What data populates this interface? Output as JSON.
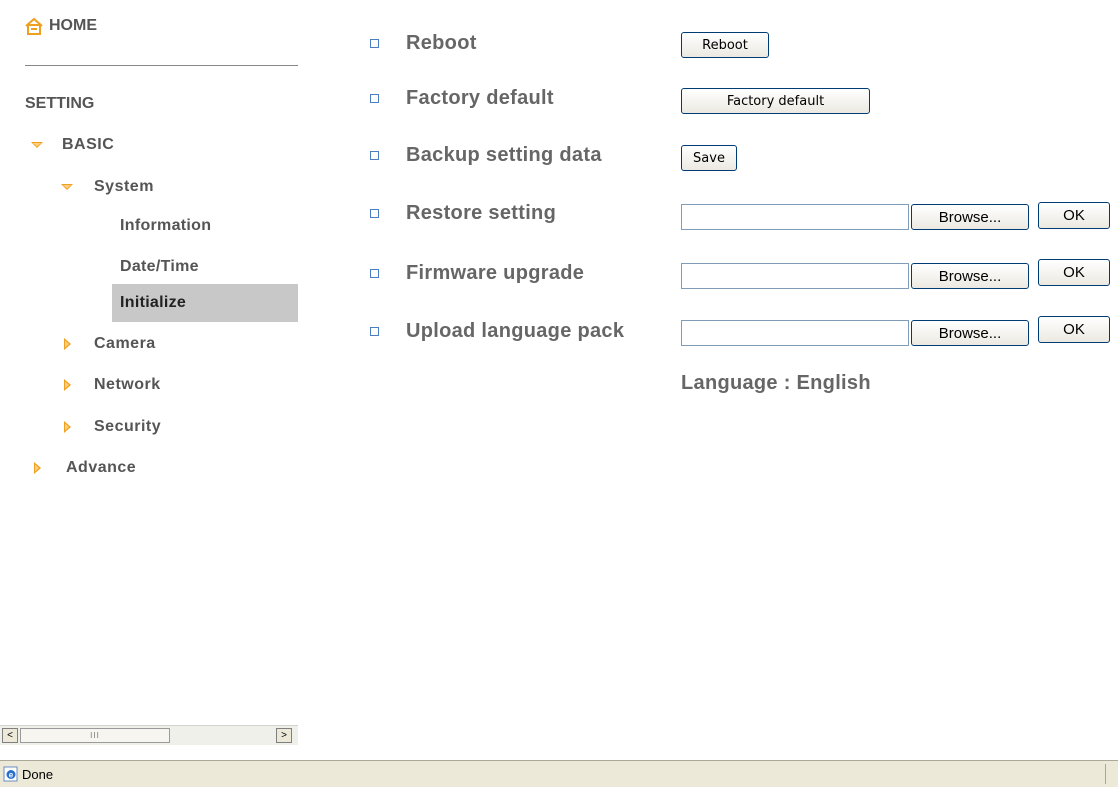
{
  "sidebar": {
    "home_label": "HOME",
    "setting_label": "SETTING",
    "basic_label": "BASIC",
    "system_label": "System",
    "information_label": "Information",
    "datetime_label": "Date/Time",
    "initialize_label": "Initialize",
    "camera_label": "Camera",
    "network_label": "Network",
    "security_label": "Security",
    "advance_label": "Advance"
  },
  "scrollbar": {
    "left_arrow": "<",
    "right_arrow": ">",
    "thumb_grip": "III"
  },
  "main": {
    "reboot": {
      "label": "Reboot",
      "button": "Reboot"
    },
    "factory_default": {
      "label": "Factory default",
      "button": "Factory default"
    },
    "backup": {
      "label": "Backup setting data",
      "button": "Save"
    },
    "restore": {
      "label": "Restore setting",
      "file_value": "",
      "browse": "Browse...",
      "ok": "OK"
    },
    "firmware": {
      "label": "Firmware upgrade",
      "file_value": "",
      "browse": "Browse...",
      "ok": "OK"
    },
    "language_pack": {
      "label": "Upload language pack",
      "file_value": "",
      "browse": "Browse...",
      "ok": "OK"
    },
    "language_text": "Language : English"
  },
  "statusbar": {
    "text": "Done"
  },
  "colors": {
    "arrow_orange": "#f0a020",
    "bullet_blue": "#4a7ec0",
    "active_bg": "#c8c8c8"
  },
  "icons": {
    "home": "home-icon",
    "expanded": "triangle-down-icon",
    "collapsed": "triangle-right-icon",
    "bullet": "square-bullet-icon",
    "ie_page": "ie-page-icon"
  }
}
